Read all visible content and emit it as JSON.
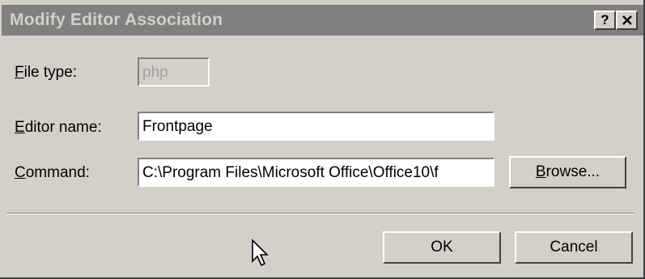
{
  "window": {
    "title": "Modify Editor Association",
    "help_label": "?",
    "close_label": "x"
  },
  "form": {
    "file_type": {
      "label_acc": "F",
      "label_rest": "ile type:",
      "value": "php"
    },
    "editor_name": {
      "label_acc": "E",
      "label_rest": "ditor name:",
      "value": "Frontpage"
    },
    "command": {
      "label_acc": "C",
      "label_rest": "ommand:",
      "value": "C:\\Program Files\\Microsoft Office\\Office10\\f"
    }
  },
  "buttons": {
    "browse": {
      "acc": "B",
      "rest": "rowse..."
    },
    "ok": "OK",
    "cancel": "Cancel"
  },
  "icons": {
    "cursor": "arrow-cursor-icon"
  },
  "colors": {
    "face": "#d4d0c8",
    "titlebar": "#808080",
    "title_text": "#d4d0c8"
  }
}
